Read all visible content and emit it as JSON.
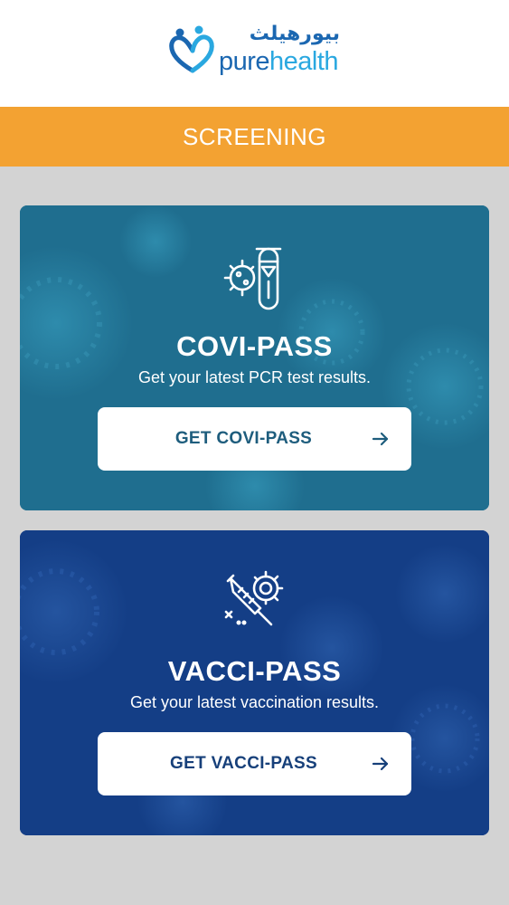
{
  "header": {
    "logo": {
      "arabic_text": "بيورهيلث",
      "latin_pure": "pure",
      "latin_health": "health"
    }
  },
  "page": {
    "title": "SCREENING"
  },
  "cards": {
    "covi": {
      "title": "COVI-PASS",
      "subtitle": "Get your latest PCR test results.",
      "button_label": "GET COVI-PASS",
      "icon": "virus-test-tube-icon"
    },
    "vacci": {
      "title": "VACCI-PASS",
      "subtitle": "Get your latest vaccination results.",
      "button_label": "GET VACCI-PASS",
      "icon": "syringe-virus-icon"
    }
  },
  "colors": {
    "title_bar": "#f3a232",
    "covi_card": "#1f6e8f",
    "vacci_card": "#143e86",
    "page_background": "#d3d3d3",
    "brand_blue": "#1b67b1"
  }
}
